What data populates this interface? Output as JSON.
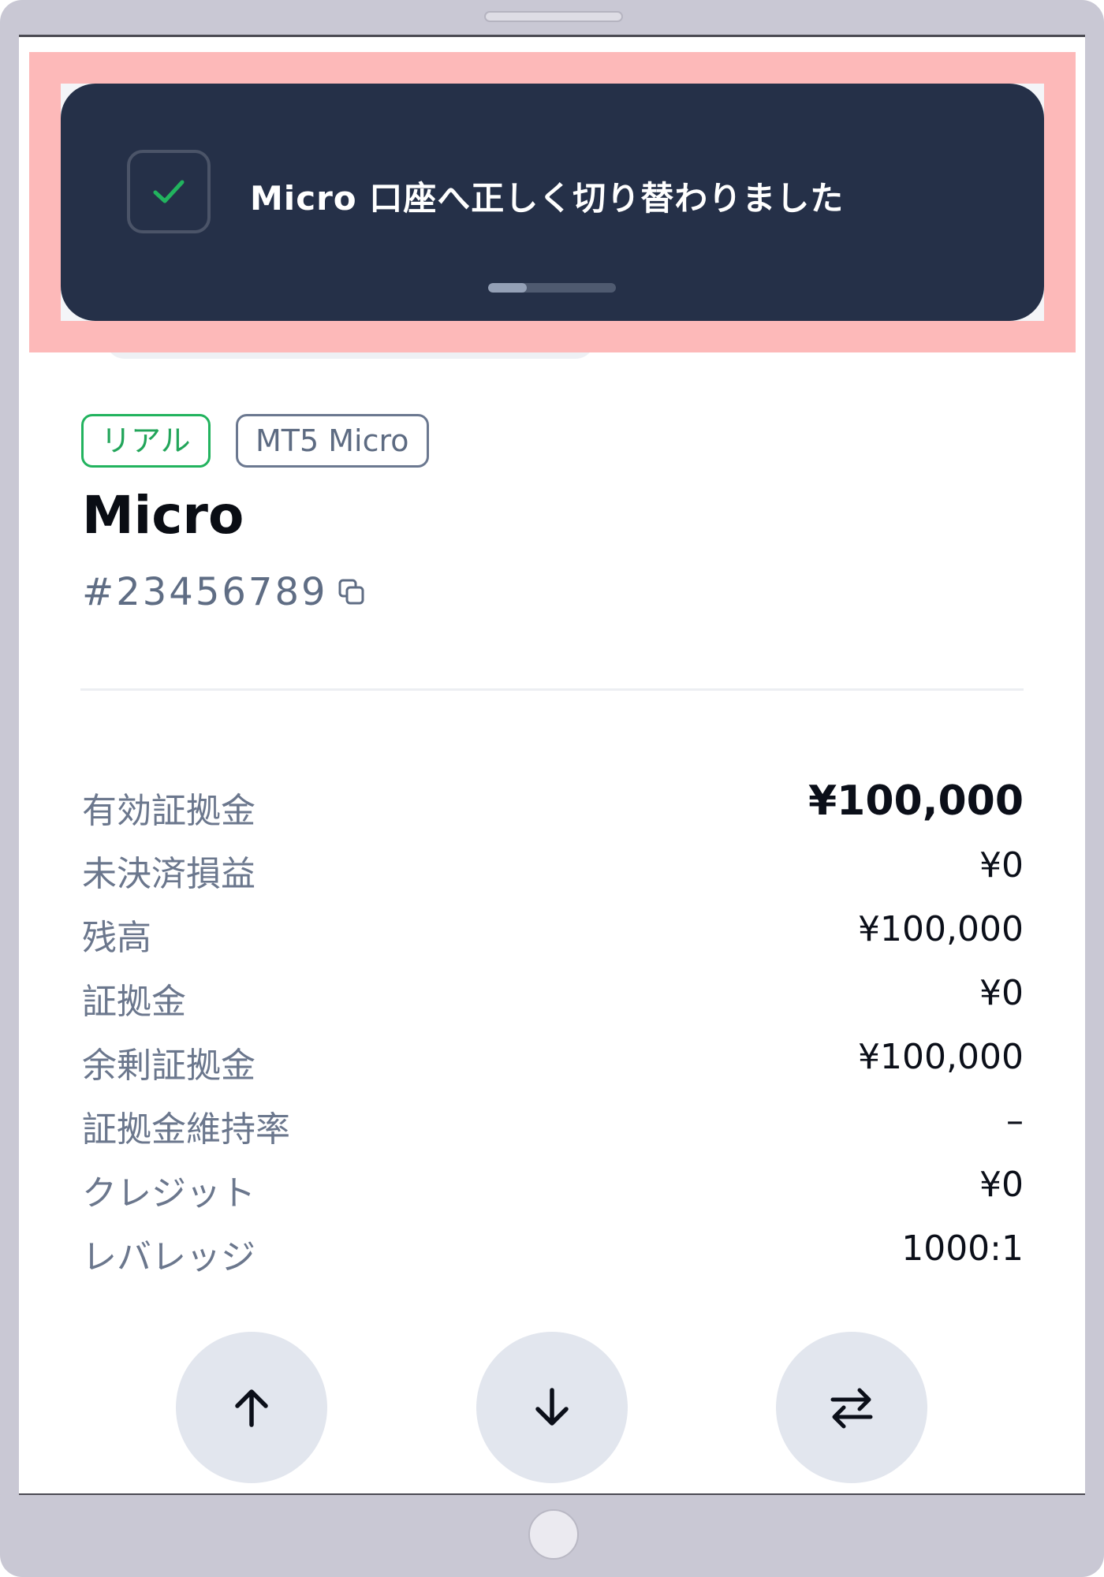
{
  "toast": {
    "message": "Micro 口座へ正しく切り替わりました",
    "icon": "check-icon",
    "progress_fraction": 0.3,
    "colors": {
      "background": "#253048",
      "check": "#22b35e",
      "highlight": "#fdb9b9"
    }
  },
  "account": {
    "tags": {
      "real": "リアル",
      "type": "MT5 Micro"
    },
    "name": "Micro",
    "number": "#23456789",
    "copy_icon": "copy-icon"
  },
  "metrics": [
    {
      "label": "有効証拠金",
      "value": "¥100,000"
    },
    {
      "label": "未決済損益",
      "value": "¥0"
    },
    {
      "label": "残高",
      "value": "¥100,000"
    },
    {
      "label": "証拠金",
      "value": "¥0"
    },
    {
      "label": "余剰証拠金",
      "value": "¥100,000"
    },
    {
      "label": "証拠金維持率",
      "value": "–"
    },
    {
      "label": "クレジット",
      "value": "¥0"
    },
    {
      "label": "レバレッジ",
      "value": "1000:1"
    }
  ],
  "actions": [
    {
      "icon": "arrow-up-icon"
    },
    {
      "icon": "arrow-down-icon"
    },
    {
      "icon": "swap-arrows-icon"
    }
  ]
}
